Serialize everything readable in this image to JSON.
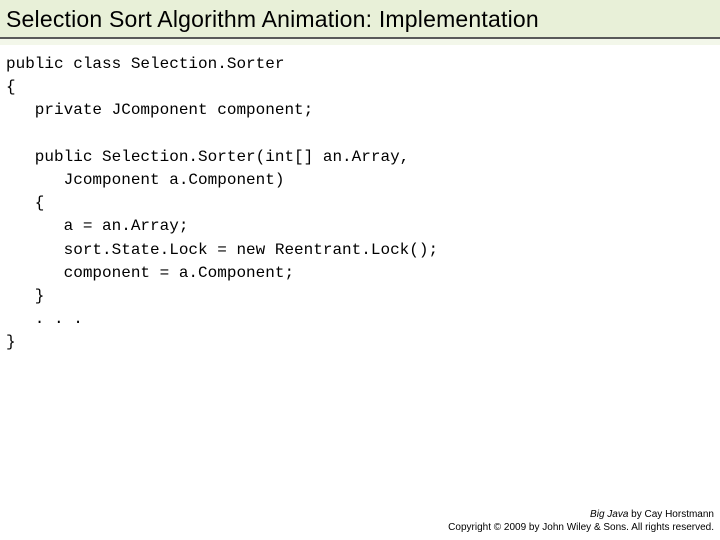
{
  "title": "Selection Sort Algorithm Animation: Implementation",
  "code": {
    "l1": "public class Selection.Sorter",
    "l2": "{",
    "l3": "   private JComponent component;",
    "l4": "",
    "l5": "   public Selection.Sorter(int[] an.Array,",
    "l6": "      Jcomponent a.Component)",
    "l7": "   {",
    "l8": "      a = an.Array;",
    "l9": "      sort.State.Lock = new Reentrant.Lock();",
    "l10": "      component = a.Component;",
    "l11": "   }",
    "l12": "   . . .",
    "l13": "}"
  },
  "footer": {
    "book": "Big Java",
    "byline": " by Cay Horstmann",
    "copyright": "Copyright © 2009 by John Wiley & Sons. All rights reserved."
  }
}
